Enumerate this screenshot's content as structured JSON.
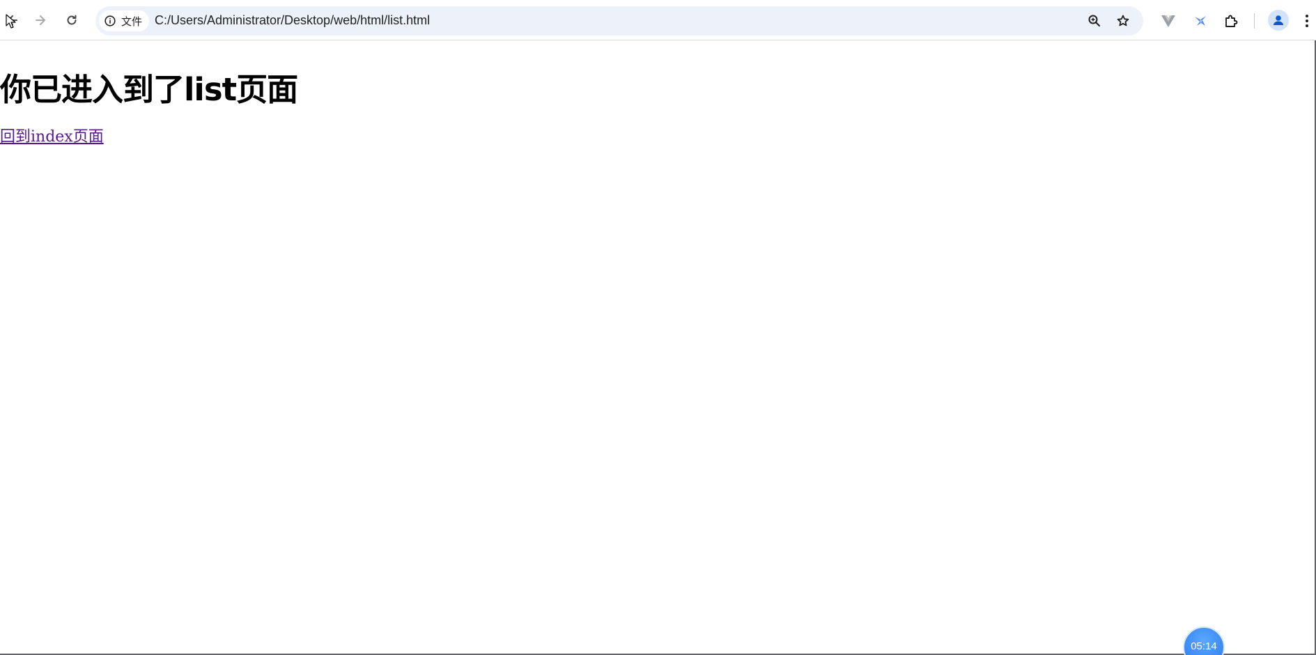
{
  "browser": {
    "site_chip_label": "文件",
    "url": "C:/Users/Administrator/Desktop/web/html/list.html",
    "icons": {
      "back": "arrow-left-icon",
      "forward": "arrow-right-icon",
      "reload": "reload-icon",
      "site_info": "info-icon",
      "zoom": "zoom-in-icon",
      "bookmark": "star-icon",
      "extensions": [
        "v-extension-icon",
        "bird-extension-icon",
        "puzzle-icon"
      ],
      "profile": "person-icon",
      "menu": "kebab-menu-icon"
    },
    "colors": {
      "omnibox_bg": "#edf2fa",
      "profile_bg": "#d3e3fd",
      "profile_fg": "#0b57d0"
    }
  },
  "page": {
    "heading": "你已进入到了list页面",
    "back_link": "回到index页面",
    "link_color": "#551a8b"
  },
  "overlay": {
    "timer": "05:14",
    "timer_color": "#3d8bf5"
  }
}
